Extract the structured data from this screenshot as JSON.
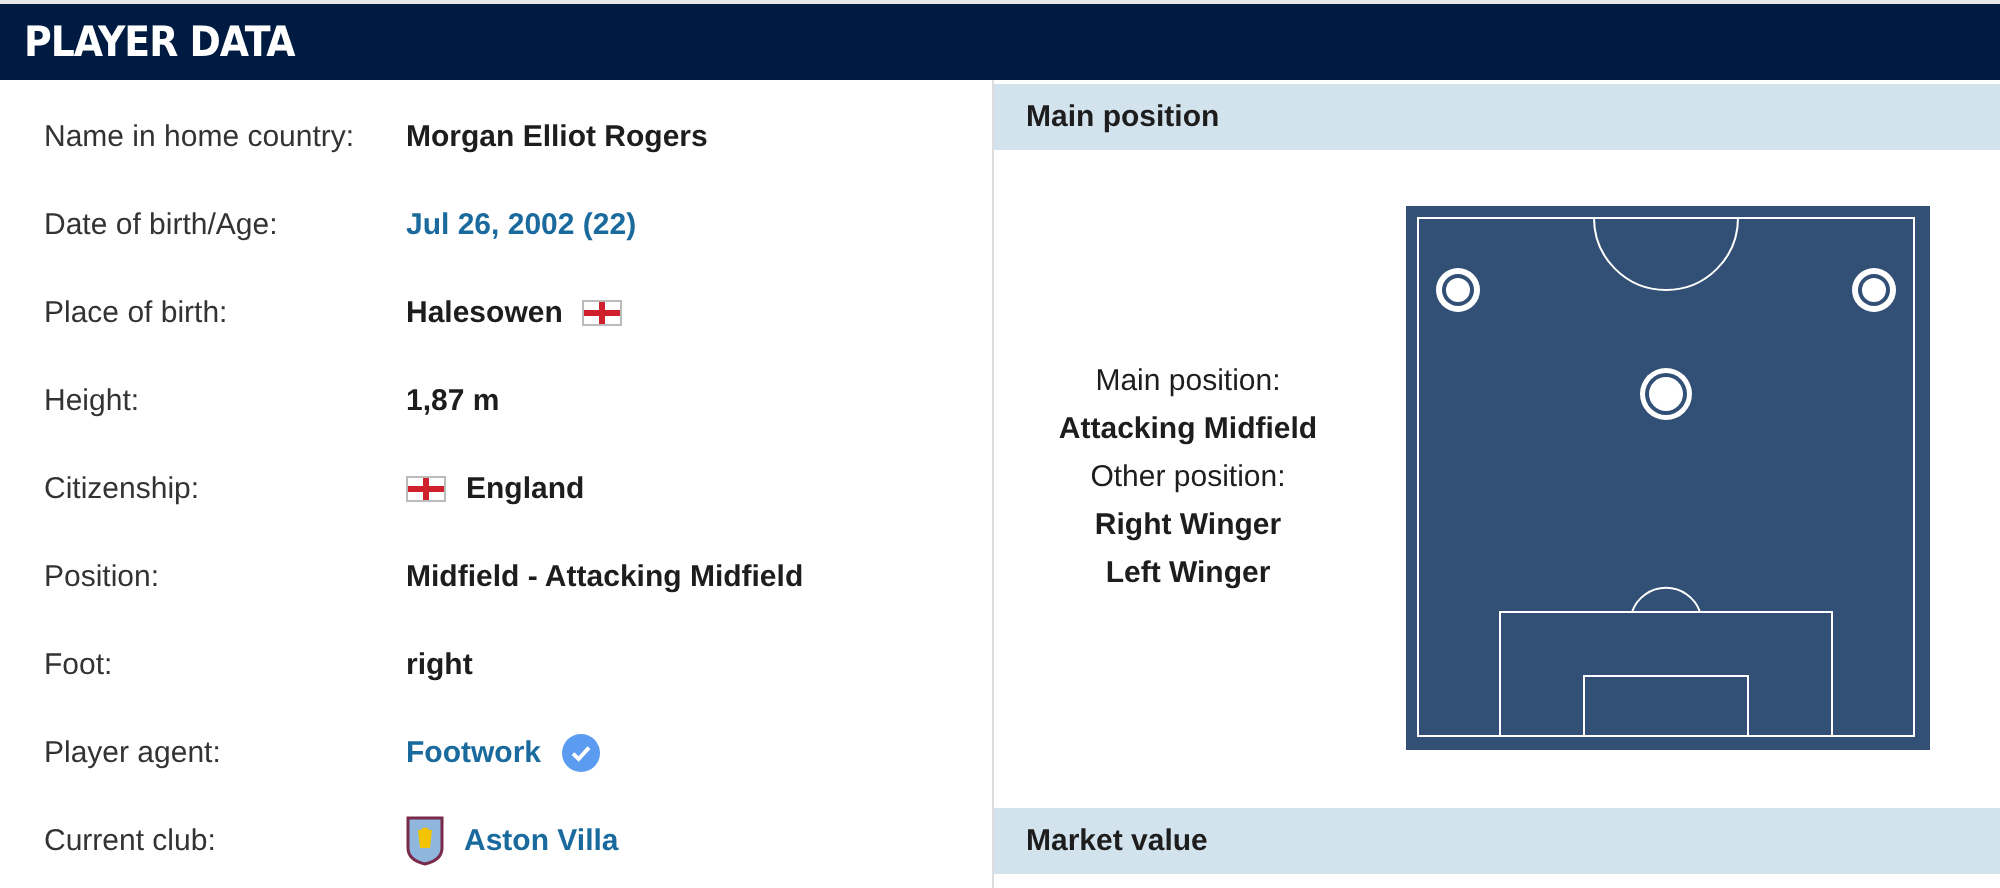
{
  "title": "PLAYER DATA",
  "rows": [
    {
      "label": "Name in home country:",
      "value": "Morgan Elliot Rogers",
      "kind": "text"
    },
    {
      "label": "Date of birth/Age:",
      "value": "Jul 26, 2002 (22)",
      "kind": "link"
    },
    {
      "label": "Place of birth:",
      "value": "Halesowen",
      "kind": "flag-after"
    },
    {
      "label": "Height:",
      "value": "1,87 m",
      "kind": "text"
    },
    {
      "label": "Citizenship:",
      "value": "England",
      "kind": "flag-before"
    },
    {
      "label": "Position:",
      "value": "Midfield - Attacking Midfield",
      "kind": "text"
    },
    {
      "label": "Foot:",
      "value": "right",
      "kind": "text"
    },
    {
      "label": "Player agent:",
      "value": "Footwork",
      "kind": "verified-link"
    },
    {
      "label": "Current club:",
      "value": "Aston Villa",
      "kind": "club-link"
    }
  ],
  "main_position_panel": {
    "title": "Main position",
    "main_label": "Main position:",
    "main_value": "Attacking Midfield",
    "other_label": "Other position:",
    "other_values": [
      "Right Winger",
      "Left Winger"
    ]
  },
  "market_value_panel": {
    "title": "Market value"
  }
}
